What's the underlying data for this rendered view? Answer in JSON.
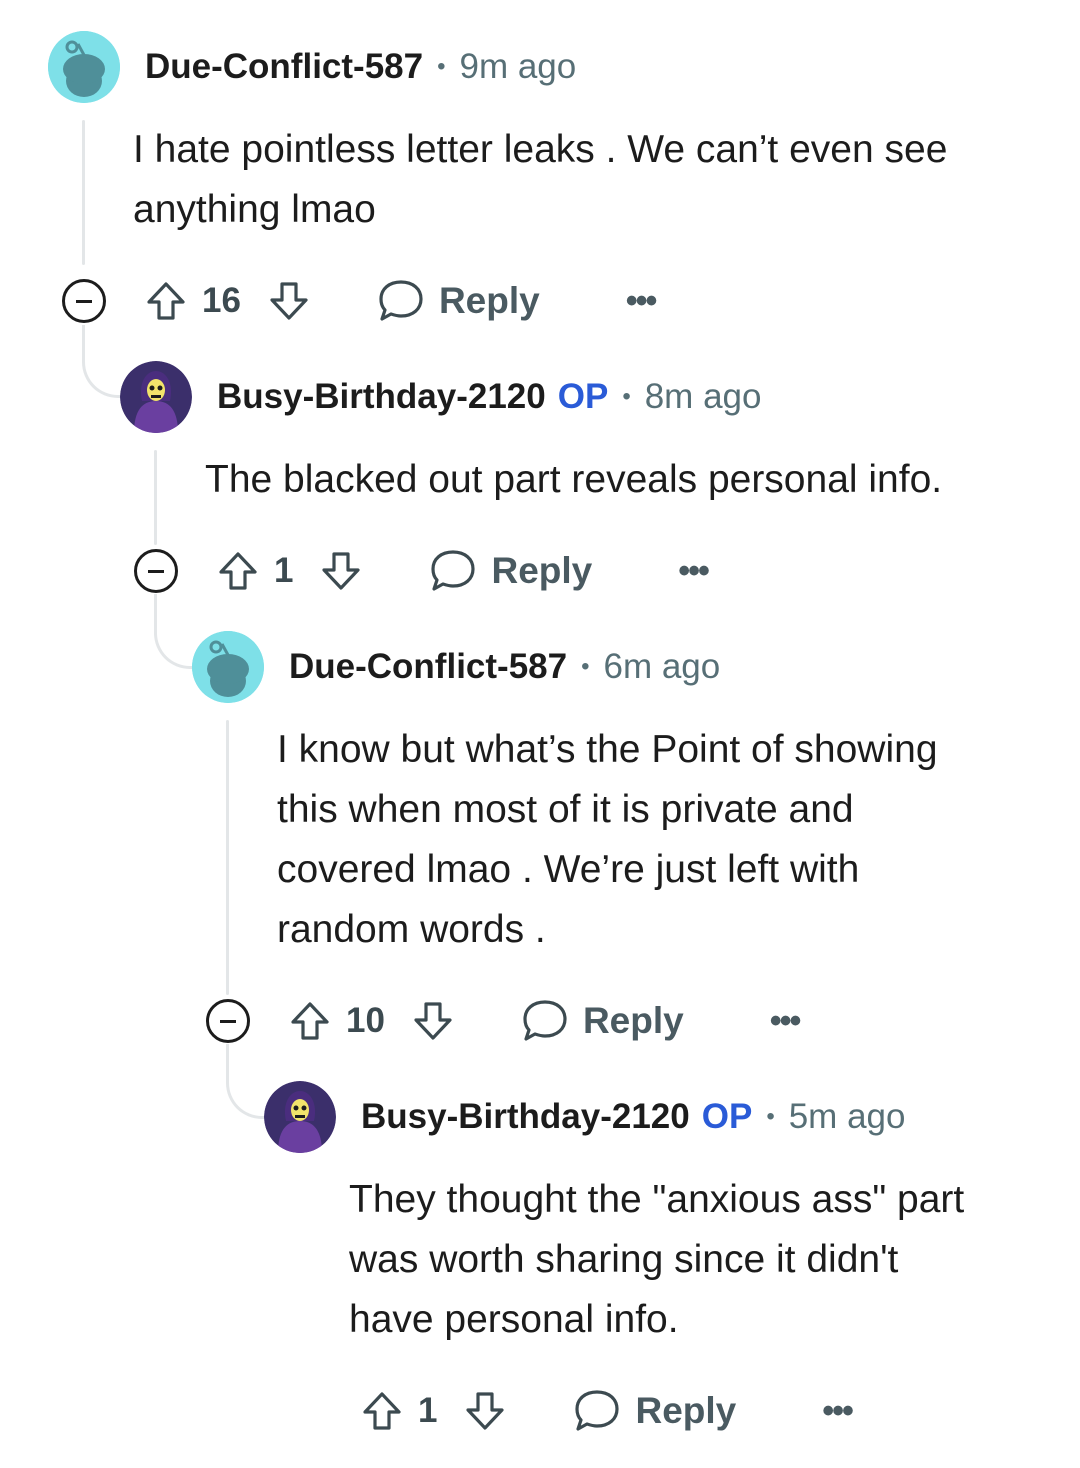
{
  "comments": [
    {
      "username": "Due-Conflict-587",
      "op": "",
      "time": "9m ago",
      "lines": [
        "I hate pointless letter leaks . We can’t even see",
        "anything lmao"
      ],
      "votes": "16",
      "reply_label": "Reply",
      "avatar_icon": "snoo-avatar-icon"
    },
    {
      "username": "Busy-Birthday-2120",
      "op": "OP",
      "time": "8m ago",
      "lines": [
        "The blacked out part reveals personal info."
      ],
      "votes": "1",
      "reply_label": "Reply",
      "avatar_icon": "skeletor-avatar-icon"
    },
    {
      "username": "Due-Conflict-587",
      "op": "",
      "time": "6m ago",
      "lines": [
        "I know but what’s the Point of showing",
        "this when most of it is private and",
        "covered lmao . We’re just left with",
        "random words ."
      ],
      "votes": "10",
      "reply_label": "Reply",
      "avatar_icon": "snoo-avatar-icon"
    },
    {
      "username": "Busy-Birthday-2120",
      "op": "OP",
      "time": "5m ago",
      "lines": [
        "They thought the \"anxious ass\" part",
        "was worth sharing since it didn't",
        "have personal info."
      ],
      "votes": "1",
      "reply_label": "Reply",
      "avatar_icon": "skeletor-avatar-icon"
    }
  ],
  "colors": {
    "op": "#2a5bd7",
    "meta": "#576f76",
    "thread_line": "#e3e6e8",
    "snoo_bg": "#7ee0e8"
  }
}
